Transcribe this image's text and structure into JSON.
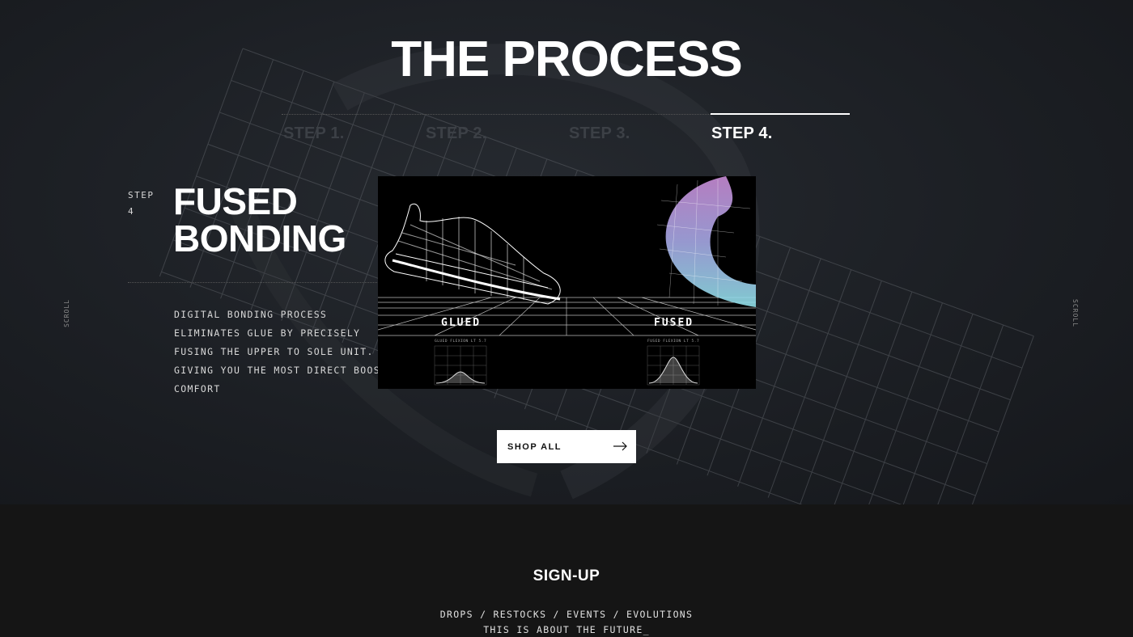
{
  "process": {
    "title": "THE PROCESS",
    "steps": [
      {
        "label": "STEP 1."
      },
      {
        "label": "STEP 2."
      },
      {
        "label": "STEP 3."
      },
      {
        "label": "STEP 4.",
        "active": true
      }
    ],
    "current_step": {
      "step_word": "STEP",
      "step_number": "4",
      "heading_line1": "FUSED",
      "heading_line2": "BONDING",
      "description": "DIGITAL BONDING PROCESS ELIMINATES GLUE BY PRECISELY FUSING THE UPPER TO SOLE UNIT. GIVING YOU THE MOST DIRECT BOOST COMFORT"
    },
    "media": {
      "label_left": "GLUED",
      "label_right": "FUSED",
      "chart_left_label": "GLUED FLEXION LT 5.7",
      "chart_right_label": "FUSED FLEXION LT 5.7"
    },
    "scroll_label": "SCROLL",
    "cta_label": "SHOP ALL"
  },
  "signup": {
    "title": "SIGN-UP",
    "line1": "DROPS / RESTOCKS / EVENTS / EVOLUTIONS",
    "line2": "THIS IS ABOUT THE FUTURE_"
  },
  "colors": {
    "background": "#1c1f24",
    "footer_background": "#151515",
    "inactive_step": "#3c4046",
    "accent_gradient": [
      "#c98bd6",
      "#8fc7e8"
    ]
  }
}
